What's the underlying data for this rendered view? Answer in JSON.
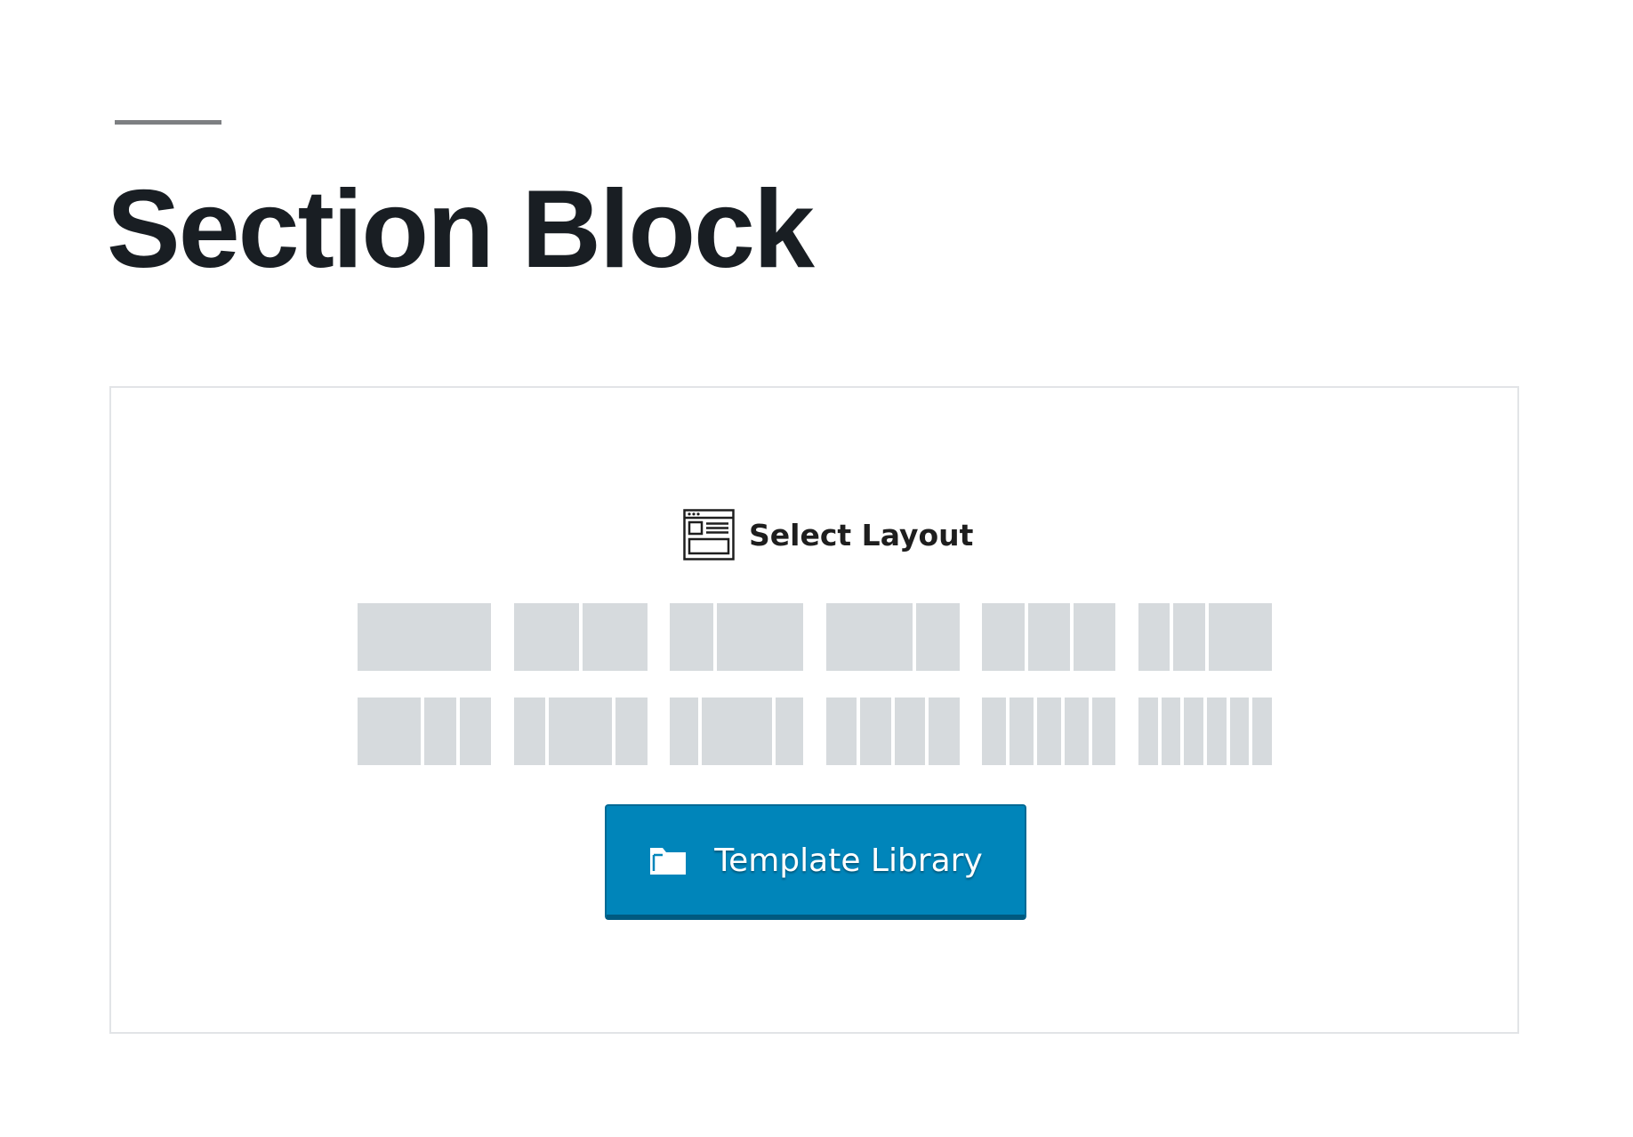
{
  "page": {
    "title": "Section Block"
  },
  "placeholder": {
    "heading": "Select Layout",
    "heading_icon": "layout-icon",
    "layouts": [
      {
        "name": "one-column",
        "columns": [
          1
        ]
      },
      {
        "name": "two-columns-equal",
        "columns": [
          1,
          1
        ]
      },
      {
        "name": "two-columns-one-third-two-thirds",
        "columns": [
          1,
          2
        ]
      },
      {
        "name": "two-columns-two-thirds-one-third",
        "columns": [
          2,
          1
        ]
      },
      {
        "name": "three-columns-equal",
        "columns": [
          1,
          1,
          1
        ]
      },
      {
        "name": "three-columns-one-quarter-one-quarter-half",
        "columns": [
          1,
          1,
          2
        ]
      },
      {
        "name": "three-columns-half-one-quarter-one-quarter",
        "columns": [
          2,
          1,
          1
        ]
      },
      {
        "name": "three-columns-one-quarter-half-one-quarter",
        "columns": [
          1,
          2,
          1
        ]
      },
      {
        "name": "three-columns-one-quarter-one-quarter-half-alt",
        "columns": [
          1,
          2.5,
          1
        ]
      },
      {
        "name": "four-columns-equal",
        "columns": [
          1,
          1,
          1,
          1
        ]
      },
      {
        "name": "five-columns-equal",
        "columns": [
          1,
          1,
          1,
          1,
          1
        ]
      },
      {
        "name": "six-columns-equal",
        "columns": [
          1,
          1,
          1,
          1,
          1,
          1
        ]
      }
    ],
    "template_button": {
      "label": "Template Library",
      "icon": "folder-icon"
    }
  },
  "colors": {
    "accent": "#0085ba",
    "accent_border": "#006a95",
    "layout_column": "#d6dadd",
    "title_text": "#191e23",
    "separator": "#7d7f82",
    "placeholder_border": "#e2e4e7"
  }
}
